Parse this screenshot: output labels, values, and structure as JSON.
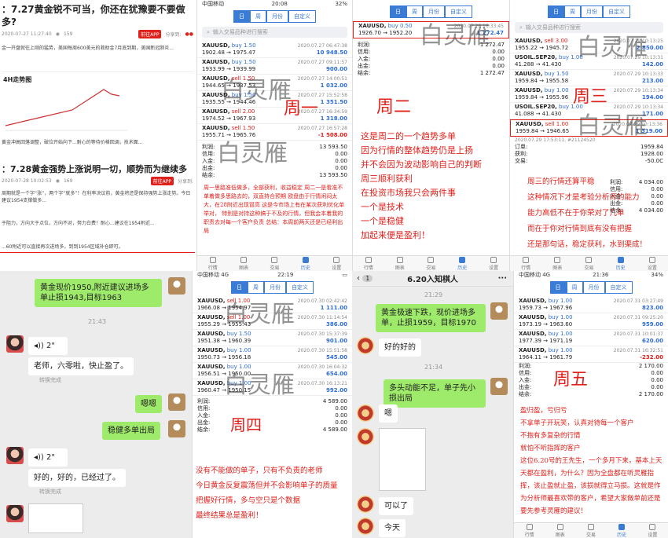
{
  "article": {
    "h1": "：7.27黄金锐不可当，你还在犹豫要不要做多?",
    "meta1": "2020-07-27 11:27:40",
    "views1": "159",
    "btn_app": "前往APP",
    "share": "分享到:",
    "para1": "金一开盘就往上刚的猛势，美国每周600美元的救助金7月底到期，美国新冠肺炎...",
    "chart_title": "4H走势图",
    "para2": "黄金冲高回落调整，破位开始向下...耐心的等待价格回调，技术面...",
    "h2": "：7.28黄金强势上涨说明一切，顺势而为继续多",
    "meta2": "2020-07-28 10:02:53",
    "views2": "169",
    "para3": "周期就是一个字“涨”，两个字“就多”！在利率决议前，黄金将还是保持强势上涨走势。今日建议1954支撑做多...",
    "para4": "于阻力，方向大于点位，方向不对，努力白费！耐心...建议在1954附近...",
    "para5": "...60附近可以直接再次进场多，到到1954区域补仓即可。"
  },
  "p1": {
    "status_carrier": "中国移动",
    "status_time": "20:08",
    "status_batt": "32%",
    "tabs": [
      "日",
      "周",
      "月份",
      "自定义"
    ],
    "search": "输入交易品种进行搜索",
    "trades": [
      {
        "sym": "XAUUSD,",
        "side": "buy 1.50",
        "type": "buy",
        "date": "2020.07.27 06:47:38",
        "range": "1902.48 → 1975.47",
        "pl": "10 948.50",
        "neg": false
      },
      {
        "sym": "XAUUSD,",
        "side": "buy 1.50",
        "type": "buy",
        "date": "2020.07.27 09:11:57",
        "range": "1933.99 → 1939.99",
        "pl": "900.00",
        "neg": false
      },
      {
        "sym": "XAUUSD,",
        "side": "sell 1.50",
        "type": "sell",
        "date": "2020.07.27 14:00:51",
        "range": "1944.65 → 1937.53",
        "pl": "1 032.00",
        "neg": false
      },
      {
        "sym": "XAUUSD,",
        "side": "buy 1.50",
        "type": "buy",
        "date": "2020.07.27 15:52:58",
        "range": "1935.55 → 1944.46",
        "pl": "1 351.50",
        "neg": false
      },
      {
        "sym": "XAUUSD,",
        "side": "sell 2.00",
        "type": "sell",
        "date": "2020.07.27 16:34:59",
        "range": "1974.52 → 1967.93",
        "pl": "1 318.00",
        "neg": false
      },
      {
        "sym": "XAUUSD,",
        "side": "sell 1.50",
        "type": "sell",
        "date": "2020.07.27 16:57:28",
        "range": "1955.71 → 1965.76",
        "pl": "-1 508.00",
        "neg": true
      }
    ],
    "summary": [
      [
        "利润:",
        "13 593.50"
      ],
      [
        "信用:",
        "0.00"
      ],
      [
        "入金:",
        "0.00"
      ],
      [
        "出金:",
        "0.00"
      ],
      [
        "结余:",
        "13 593.50"
      ]
    ],
    "note": "周一思路准低做多，全部获利，收益稳定 周二一是看准不单着做多思路去的，双直持合预期 欧盘由于行情闲闷太大，在28附近出现冒高 这是今市场上有在某次获利优化单举对， 特别是对持这种搞于不及的行情，但我会本着我的职责去对每一个客户负责 总结：本周前两天还是已经利出局",
    "nav": [
      "行情",
      "图表",
      "交易",
      "历史",
      "设置"
    ]
  },
  "p2": {
    "tabs": [
      "日",
      "周",
      "月份",
      "自定义"
    ],
    "trade": {
      "sym": "XAUUSD,",
      "side": "buy 0.50",
      "date": "2020.07.28 16:33:45",
      "range": "1926.70 → 1952.20",
      "pl": "1 272.47"
    },
    "summary": [
      [
        "利润:",
        "1 272.47"
      ],
      [
        "信用:",
        "0.00"
      ],
      [
        "入金:",
        "0.00"
      ],
      [
        "出金:",
        "0.00"
      ],
      [
        "结余:",
        "1 272.47"
      ]
    ],
    "day": "周二",
    "notes": [
      "这是周二的一个趋势多单",
      "因为行情的整体趋势仍是上扬",
      "并不会因为波动影响自己的判断",
      "周三顺利获利",
      "在投资市场我只会两件事",
      "一个是技术",
      "一个是稳健",
      "加起来便是盈利！"
    ]
  },
  "p3": {
    "tabs": [
      "日",
      "周",
      "月份",
      "自定义"
    ],
    "search": "输入交易品种进行搜索",
    "trades": [
      {
        "sym": "XAUUSD,",
        "side": "sell 3.00",
        "type": "sell",
        "date": "2020.07.29 10:13:25",
        "range": "1955.22 → 1945.72",
        "pl": "2 850.00"
      },
      {
        "sym": "USOIL.SEP20,",
        "side": "buy 1.00",
        "type": "buy",
        "date": "2020.07.29 10:13:31",
        "range": "41.288 → 41.430",
        "pl": "142.00"
      },
      {
        "sym": "XAUUSD,",
        "side": "buy 1.50",
        "type": "buy",
        "date": "2020.07.29 10:13:33",
        "range": "1959.84 → 1955.58",
        "pl": "213.00"
      },
      {
        "sym": "XAUUSD,",
        "side": "buy 1.00",
        "type": "buy",
        "date": "2020.07.29 10:13:34",
        "range": "1959.84 → 1955.96",
        "pl": "194.00"
      },
      {
        "sym": "USOIL.SEP20,",
        "side": "buy 1.00",
        "type": "buy",
        "date": "2020.07.29 10:13:34",
        "range": "41.088 → 41.430",
        "pl": "171.00"
      },
      {
        "sym": "XAUUSD,",
        "side": "sell 1.00",
        "type": "sell",
        "date": "2020.07.29 10:13:36",
        "range": "1959.84 → 1946.65",
        "pl": "1 319.00"
      }
    ],
    "detail": "2020.07.29 17:53:11, #21124520",
    "extra": [
      [
        "订单:",
        "1959.84"
      ],
      [
        "获利:",
        "1928.00"
      ],
      [
        "交易:",
        "-50.0C"
      ]
    ],
    "day": "周三",
    "notes": [
      "周三的行情还算平稳",
      "这种情况下才是考验分析师的能力",
      "能力高低不在于你荣对了几单",
      "而在于你对行情到底有没有把握",
      "还是那句话，稳定获利，水到渠成！"
    ],
    "summary": [
      [
        "利润:",
        "4 034.00"
      ],
      [
        "信用:",
        "0.00"
      ],
      [
        "入金:",
        "0.00"
      ],
      [
        "出金:",
        "0.00"
      ],
      [
        "结余:",
        "4 034.00"
      ]
    ]
  },
  "chat1": {
    "m1": "黄金现价1950,附近建议进场多单止损1943,目标1963",
    "t1": "21:43",
    "voice": "2\"",
    "tr": "转换完成",
    "m2": "老师，六零啦，快止盈了。",
    "m3": "嗯嗯",
    "m4": "稳健多单出局",
    "voice2": "2\"",
    "m5": "好的，好的，已经过了。",
    "tr2": "转换完成"
  },
  "p4": {
    "status_carrier": "中国移动 4G",
    "status_time": "22:19",
    "tabs": [
      "日",
      "周",
      "月份",
      "自定义"
    ],
    "trades": [
      {
        "sym": "XAUUSD,",
        "side": "sell 1.00",
        "type": "sell",
        "date": "2020.07.30 02:42:42",
        "range": "1966.08 → 1954.97",
        "pl": "1 111.00"
      },
      {
        "sym": "XAUUSD,",
        "side": "sell 1.00",
        "type": "sell",
        "date": "2020.07.30 11:14:54",
        "range": "1955.29 → 1955.43",
        "pl": "386.00"
      },
      {
        "sym": "XAUUSD,",
        "side": "buy 1.50",
        "type": "buy",
        "date": "2020.07.30 15:37:39",
        "range": "1951.38 → 1960.39",
        "pl": "901.00"
      },
      {
        "sym": "XAUUSD,",
        "side": "buy 1.00",
        "type": "buy",
        "date": "2020.07.30 15:51:58",
        "range": "1950.73 → 1956.18",
        "pl": "545.00"
      },
      {
        "sym": "XAUUSD,",
        "side": "buy 1.00",
        "type": "buy",
        "date": "2020.07.30 16:04:32",
        "range": "1956.51 → 1950.00",
        "pl": "654.00"
      },
      {
        "sym": "XAUUSD,",
        "side": "buy 1.00",
        "type": "buy",
        "date": "2020.07.30 16:13:21",
        "range": "1960.47 → 1950.15",
        "pl": "992.00"
      }
    ],
    "summary": [
      [
        "利润:",
        "4 589.00"
      ],
      [
        "信用:",
        "0.00"
      ],
      [
        "入金:",
        "0.00"
      ],
      [
        "出金:",
        "0.00"
      ],
      [
        "结余:",
        "4 589.00"
      ]
    ],
    "day": "周四",
    "notes": [
      "没有不能做的单子，只有不负责的老师",
      "今日黄金反复震荡但并不会影响单子的质量",
      "把握好行情，多与空只是个数据",
      "最终结果总是盈利！"
    ]
  },
  "chat2": {
    "title": "6.20入知棋人",
    "badge": "1",
    "t1": "21:29",
    "m1": "黄金极速下跌，现价进场多单，止损1959，目标1970",
    "m2": "好的好的",
    "t2": "21:34",
    "m3": "多头动能不足，单子先小损出局",
    "m4": "嗯",
    "m5": "可以了",
    "m6": "今天"
  },
  "p5": {
    "status_carrier": "中国移动 4G",
    "status_time": "21:36",
    "status_batt": "34%",
    "tabs": [
      "日",
      "周",
      "月份",
      "自定义"
    ],
    "trades": [
      {
        "sym": "XAUUSD,",
        "side": "buy 1.00",
        "type": "buy",
        "date": "2020.07.31 03:27:49",
        "range": "1959.73 → 1967.96",
        "pl": "823.00"
      },
      {
        "sym": "XAUUSD,",
        "side": "buy 1.00",
        "type": "buy",
        "date": "2020.07.31 09:25:20",
        "range": "1973.19 → 1963.60",
        "pl": "959.00"
      },
      {
        "sym": "XAUUSD,",
        "side": "buy 1.00",
        "type": "buy",
        "date": "2020.07.31 10:01:37",
        "range": "1977.39 → 1971.19",
        "pl": "620.00"
      },
      {
        "sym": "XAUUSD,",
        "side": "buy 1.00",
        "type": "buy",
        "date": "2020.07.31 16:32:51",
        "range": "1964.11 → 1961.79",
        "pl": "-232.00"
      }
    ],
    "summary": [
      [
        "利润:",
        "2 170.00"
      ],
      [
        "信用:",
        "0.00"
      ],
      [
        "入金:",
        "0.00"
      ],
      [
        "出金:",
        "0.00"
      ],
      [
        "结余:",
        "2 170.00"
      ]
    ],
    "day": "周五",
    "notes": [
      "盈归盈，亏归亏",
      "不拿单子开玩笑，认真对待每一个客户",
      "不抱有多复杂的行情",
      "就怕不听指挥的客户",
      "这位6.20号的王先生，一个多月下来，基本上天天都在盈利，为什么？因为全盘都在听灵雁指挥，该止盈就止盈，该损就得立马损。这就是作为分析师最喜欢带的客户，希望大家做单前还是要先参考灵雁的建议！"
    ]
  },
  "watermark": "白灵雁"
}
